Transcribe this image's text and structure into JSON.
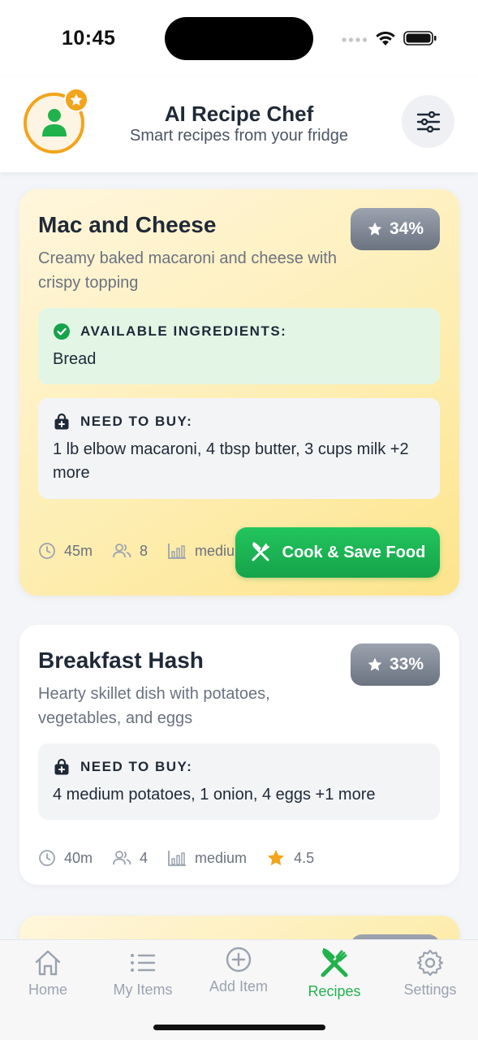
{
  "status_bar": {
    "time": "10:45"
  },
  "header": {
    "title": "AI Recipe Chef",
    "subtitle": "Smart recipes from your fridge"
  },
  "recipes": [
    {
      "title": "Mac and Cheese",
      "description": "Creamy baked macaroni and cheese with crispy topping",
      "match": "34%",
      "available_label": "AVAILABLE INGREDIENTS:",
      "available": "Bread",
      "buy_label": "NEED TO BUY:",
      "buy": "1 lb elbow macaroni, 4 tbsp butter, 3 cups milk +2 more",
      "time": "45m",
      "servings": "8",
      "difficulty": "medium",
      "action_label": "Cook & Save Food"
    },
    {
      "title": "Breakfast Hash",
      "description": "Hearty skillet dish with potatoes, vegetables, and eggs",
      "match": "33%",
      "buy_label": "NEED TO BUY:",
      "buy": "4 medium potatoes, 1 onion, 4 eggs +1 more",
      "time": "40m",
      "servings": "4",
      "difficulty": "medium",
      "rating": "4.5"
    }
  ],
  "tabs": [
    {
      "label": "Home",
      "icon": "home-icon"
    },
    {
      "label": "My Items",
      "icon": "list-icon"
    },
    {
      "label": "Add Item",
      "icon": "plus-circle-icon"
    },
    {
      "label": "Recipes",
      "icon": "utensils-icon",
      "active": true
    },
    {
      "label": "Settings",
      "icon": "gear-icon"
    }
  ],
  "colors": {
    "accent_green": "#22b24c",
    "avatar_orange": "#f2a41a",
    "highlight_card": "#fde9a3",
    "badge_gray": "#8b8f97"
  }
}
